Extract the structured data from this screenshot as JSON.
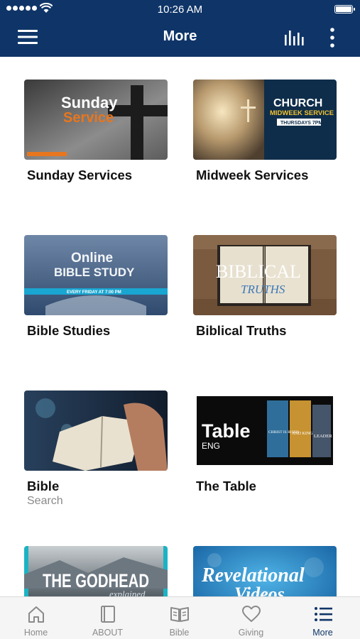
{
  "status_bar": {
    "time": "10:26 AM"
  },
  "nav": {
    "title": "More"
  },
  "tiles": [
    {
      "name": "Sunday Services",
      "subtitle": "",
      "thumb": {
        "line1": "Sunday",
        "line2": "Service"
      }
    },
    {
      "name": "Midweek Services",
      "subtitle": "",
      "thumb": {
        "line1": "CHURCH",
        "line2": "MIDWEEK SERVICE",
        "line3": "THURSDAYS 7PM"
      }
    },
    {
      "name": "Bible Studies",
      "subtitle": "",
      "thumb": {
        "line1": "Online",
        "line2": "BIBLE STUDY",
        "line3": "EVERY FRIDAY AT 7:00 PM"
      }
    },
    {
      "name": "Biblical Truths",
      "subtitle": "",
      "thumb": {
        "line1": "BIBLICAL",
        "line2": "TRUTHS"
      }
    },
    {
      "name": "Bible",
      "subtitle": "Search",
      "thumb": {}
    },
    {
      "name": "The Table",
      "subtitle": "",
      "thumb": {
        "line1": "Table",
        "line2": "ENG",
        "book1": "CHRIST IS RISEN",
        "book2": "AND KING",
        "book3": "LEADER"
      }
    },
    {
      "name": "",
      "subtitle": "",
      "thumb": {
        "line1": "THE GODHEAD",
        "line2": "explained"
      }
    },
    {
      "name": "",
      "subtitle": "",
      "thumb": {
        "line1": "Revelational",
        "line2": "Videos"
      }
    }
  ],
  "tabs": [
    {
      "label": "Home",
      "icon": "home-icon",
      "active": false
    },
    {
      "label": "ABOUT",
      "icon": "book-icon",
      "active": false
    },
    {
      "label": "Bible",
      "icon": "open-book-icon",
      "active": false
    },
    {
      "label": "Giving",
      "icon": "heart-icon",
      "active": false
    },
    {
      "label": "More",
      "icon": "list-icon",
      "active": true
    }
  ],
  "colors": {
    "brand": "#0f3568",
    "active_tab": "#0f3568",
    "inactive_tab": "#8a8a8a"
  }
}
